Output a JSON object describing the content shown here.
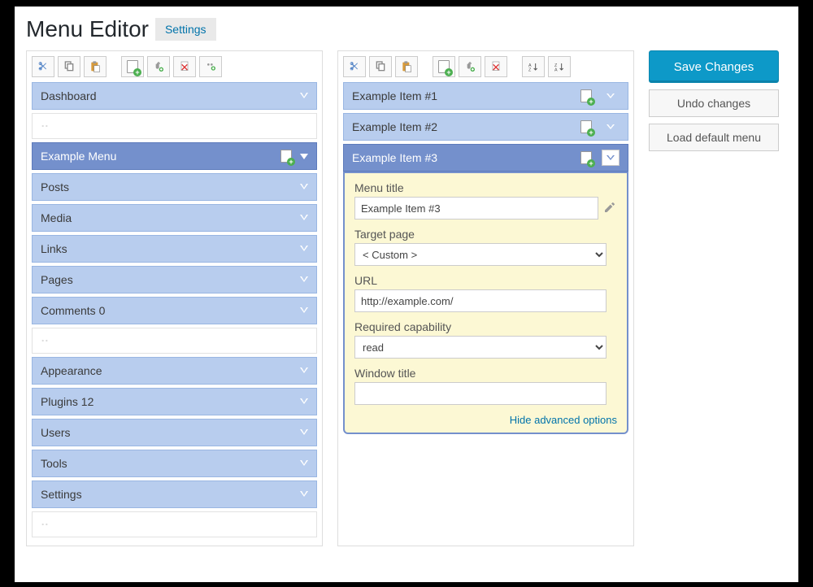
{
  "header": {
    "title": "Menu Editor",
    "tab": "Settings"
  },
  "toolbar_left": {
    "cut": "cut",
    "copy": "copy",
    "paste": "paste",
    "new_menu": "new-menu",
    "plugin": "new-plugin",
    "delete": "delete",
    "add_separator": "add-separator"
  },
  "toolbar_right": {
    "cut": "cut",
    "copy": "copy",
    "paste": "paste",
    "new_item": "new-item",
    "plugin": "new-plugin",
    "delete": "delete",
    "sort_asc": "sort-asc",
    "sort_desc": "sort-desc"
  },
  "left_menu": [
    {
      "label": "Dashboard",
      "selected": false,
      "type": "item"
    },
    {
      "type": "separator"
    },
    {
      "label": "Example Menu",
      "selected": true,
      "type": "item",
      "icon": true
    },
    {
      "label": "Posts",
      "selected": false,
      "type": "item"
    },
    {
      "label": "Media",
      "selected": false,
      "type": "item"
    },
    {
      "label": "Links",
      "selected": false,
      "type": "item"
    },
    {
      "label": "Pages",
      "selected": false,
      "type": "item"
    },
    {
      "label": "Comments 0",
      "selected": false,
      "type": "item"
    },
    {
      "type": "separator"
    },
    {
      "label": "Appearance",
      "selected": false,
      "type": "item"
    },
    {
      "label": "Plugins 12",
      "selected": false,
      "type": "item"
    },
    {
      "label": "Users",
      "selected": false,
      "type": "item"
    },
    {
      "label": "Tools",
      "selected": false,
      "type": "item"
    },
    {
      "label": "Settings",
      "selected": false,
      "type": "item"
    },
    {
      "type": "separator"
    }
  ],
  "right_items": [
    {
      "label": "Example Item #1",
      "open": false
    },
    {
      "label": "Example Item #2",
      "open": false
    },
    {
      "label": "Example Item #3",
      "open": true
    }
  ],
  "editor": {
    "menu_title_label": "Menu title",
    "menu_title_value": "Example Item #3",
    "target_page_label": "Target page",
    "target_page_value": "< Custom >",
    "url_label": "URL",
    "url_value": "http://example.com/",
    "capability_label": "Required capability",
    "capability_value": "read",
    "window_title_label": "Window title",
    "window_title_value": "",
    "hide_link": "Hide advanced options"
  },
  "actions": {
    "save": "Save Changes",
    "undo": "Undo changes",
    "load_default": "Load default menu"
  }
}
